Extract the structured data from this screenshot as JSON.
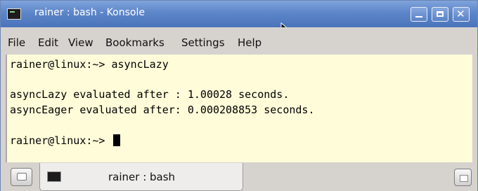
{
  "window": {
    "title": "rainer : bash - Konsole",
    "app_icon": "terminal-icon",
    "controls": {
      "minimize": "minimize-icon",
      "maximize": "maximize-icon",
      "close_label": "✕"
    }
  },
  "menubar": {
    "items": [
      "File",
      "Edit",
      "View",
      "Bookmarks",
      "Settings",
      "Help"
    ]
  },
  "terminal": {
    "lines": [
      "rainer@linux:~> asyncLazy",
      "",
      "asyncLazy evaluated after : 1.00028 seconds.",
      "asyncEager evaluated after: 0.000208853 seconds.",
      "",
      "rainer@linux:~> "
    ],
    "background": "#fffcd9"
  },
  "tabbar": {
    "tabs": [
      {
        "label": "rainer : bash",
        "icon": "terminal-icon"
      }
    ],
    "new_tab_icon": "new-tab-icon",
    "close_tab_icon": "close-tab-icon",
    "close_tab_glyph": "✖"
  },
  "colors": {
    "titlebar": "#5d86c9",
    "chrome": "#d6d2ce"
  }
}
